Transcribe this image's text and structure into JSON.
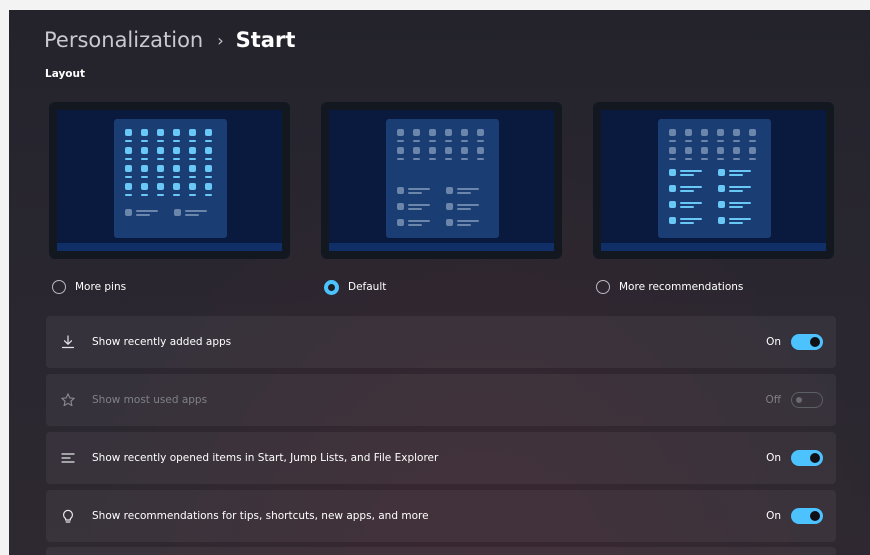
{
  "header": {
    "parent": "Personalization",
    "separator": "›",
    "current": "Start"
  },
  "section_title": "Layout",
  "layout_options": [
    {
      "label": "More pins",
      "selected": false
    },
    {
      "label": "Default",
      "selected": true
    },
    {
      "label": "More recommendations",
      "selected": false
    }
  ],
  "settings": [
    {
      "label": "Show recently added apps",
      "icon": "download-icon",
      "state": "On",
      "enabled": true
    },
    {
      "label": "Show most used apps",
      "icon": "star-icon",
      "state": "Off",
      "enabled": false
    },
    {
      "label": "Show recently opened items in Start, Jump Lists, and File Explorer",
      "icon": "lines-icon",
      "state": "On",
      "enabled": true
    },
    {
      "label": "Show recommendations for tips, shortcuts, new apps, and more",
      "icon": "lightbulb-icon",
      "state": "On",
      "enabled": true
    }
  ],
  "colors": {
    "accent": "#4cc2ff",
    "background": "#26242d",
    "card": "#302e37"
  }
}
